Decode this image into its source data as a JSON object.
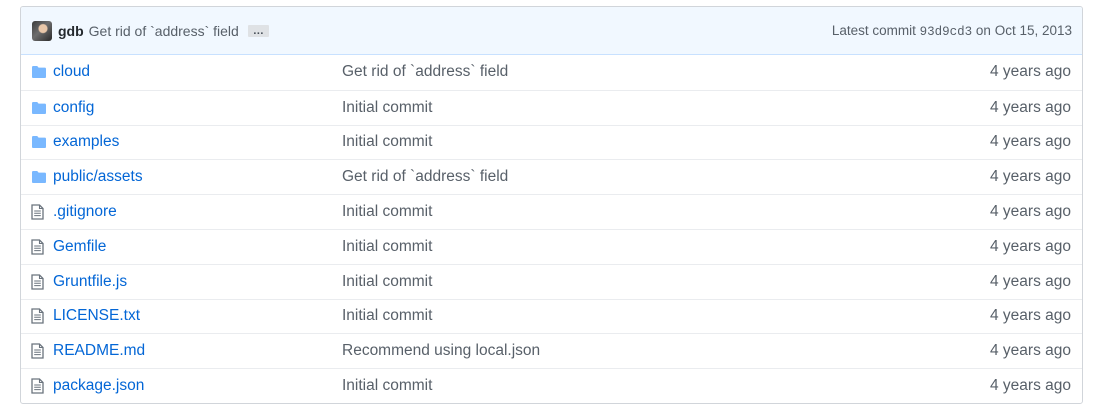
{
  "commit": {
    "author": "gdb",
    "message": "Get rid of `address` field",
    "ellipsis": "…",
    "latest_label": "Latest commit",
    "sha": "93d9cd3",
    "on_label": "on",
    "date": "Oct 15, 2013"
  },
  "files": [
    {
      "type": "folder",
      "name": "cloud",
      "message": "Get rid of `address` field",
      "age": "4 years ago"
    },
    {
      "type": "folder",
      "name": "config",
      "message": "Initial commit",
      "age": "4 years ago"
    },
    {
      "type": "folder",
      "name": "examples",
      "message": "Initial commit",
      "age": "4 years ago"
    },
    {
      "type": "folder",
      "name": "public/assets",
      "message": "Get rid of `address` field",
      "age": "4 years ago"
    },
    {
      "type": "file",
      "name": ".gitignore",
      "message": "Initial commit",
      "age": "4 years ago"
    },
    {
      "type": "file",
      "name": "Gemfile",
      "message": "Initial commit",
      "age": "4 years ago"
    },
    {
      "type": "file",
      "name": "Gruntfile.js",
      "message": "Initial commit",
      "age": "4 years ago"
    },
    {
      "type": "file",
      "name": "LICENSE.txt",
      "message": "Initial commit",
      "age": "4 years ago"
    },
    {
      "type": "file",
      "name": "README.md",
      "message": "Recommend using local.json",
      "age": "4 years ago"
    },
    {
      "type": "file",
      "name": "package.json",
      "message": "Initial commit",
      "age": "4 years ago"
    }
  ],
  "colors": {
    "link": "#0366d6",
    "muted": "#586069",
    "folder_icon": "#79b8ff",
    "file_icon": "#6a737d",
    "commit_bar_bg": "#f1f8ff"
  }
}
